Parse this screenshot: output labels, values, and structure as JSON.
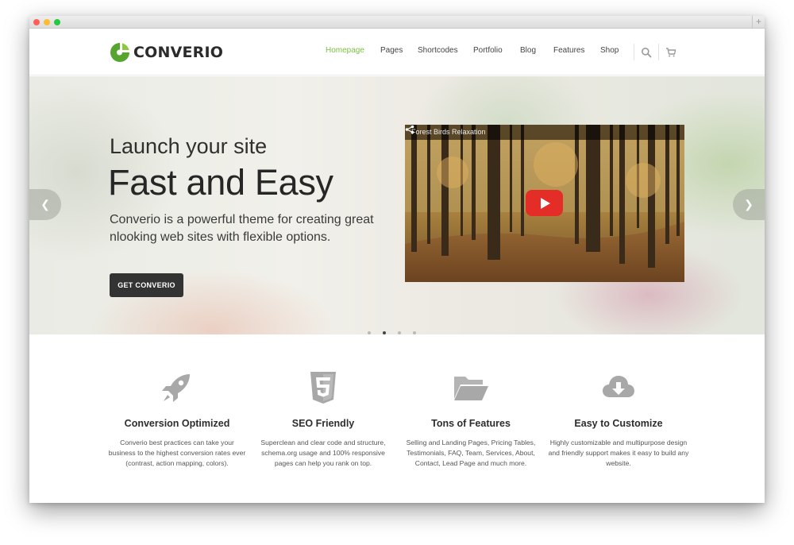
{
  "brand": {
    "name": "CONVERIO",
    "accent_color": "#7cc142"
  },
  "nav": {
    "items": [
      {
        "label": "Homepage",
        "active": true
      },
      {
        "label": "Pages",
        "active": false
      },
      {
        "label": "Shortcodes",
        "active": false
      },
      {
        "label": "Portfolio",
        "active": false
      },
      {
        "label": "Blog",
        "active": false
      },
      {
        "label": "Features",
        "active": false
      },
      {
        "label": "Shop",
        "active": false
      }
    ],
    "icons": [
      "search-icon",
      "cart-icon"
    ]
  },
  "hero": {
    "line1": "Launch your site",
    "line2": "Fast and Easy",
    "description": "Converio is a powerful theme for creating great nlooking web sites with flexible options.",
    "button": "GET CONVERIO",
    "video": {
      "title": "Forest Birds Relaxation"
    },
    "slider": {
      "slide_count": 4,
      "active_index": 1
    }
  },
  "features": [
    {
      "icon": "rocket-icon",
      "title": "Conversion Optimized",
      "description": "Converio best practices can take your business to the highest conversion rates ever (contrast, action mapping, colors)."
    },
    {
      "icon": "html5-icon",
      "title": "SEO Friendly",
      "description": "Superclean and clear code and structure, schema.org usage and 100% responsive pages can help you rank on top."
    },
    {
      "icon": "folder-open-icon",
      "title": "Tons of Features",
      "description": "Selling and Landing Pages, Pricing Tables, Testimonials, FAQ, Team, Services, About, Contact, Lead Page and much more."
    },
    {
      "icon": "cloud-download-icon",
      "title": "Easy to Customize",
      "description": "Highly customizable and multipurpose design and friendly support makes it easy to build any website."
    }
  ]
}
